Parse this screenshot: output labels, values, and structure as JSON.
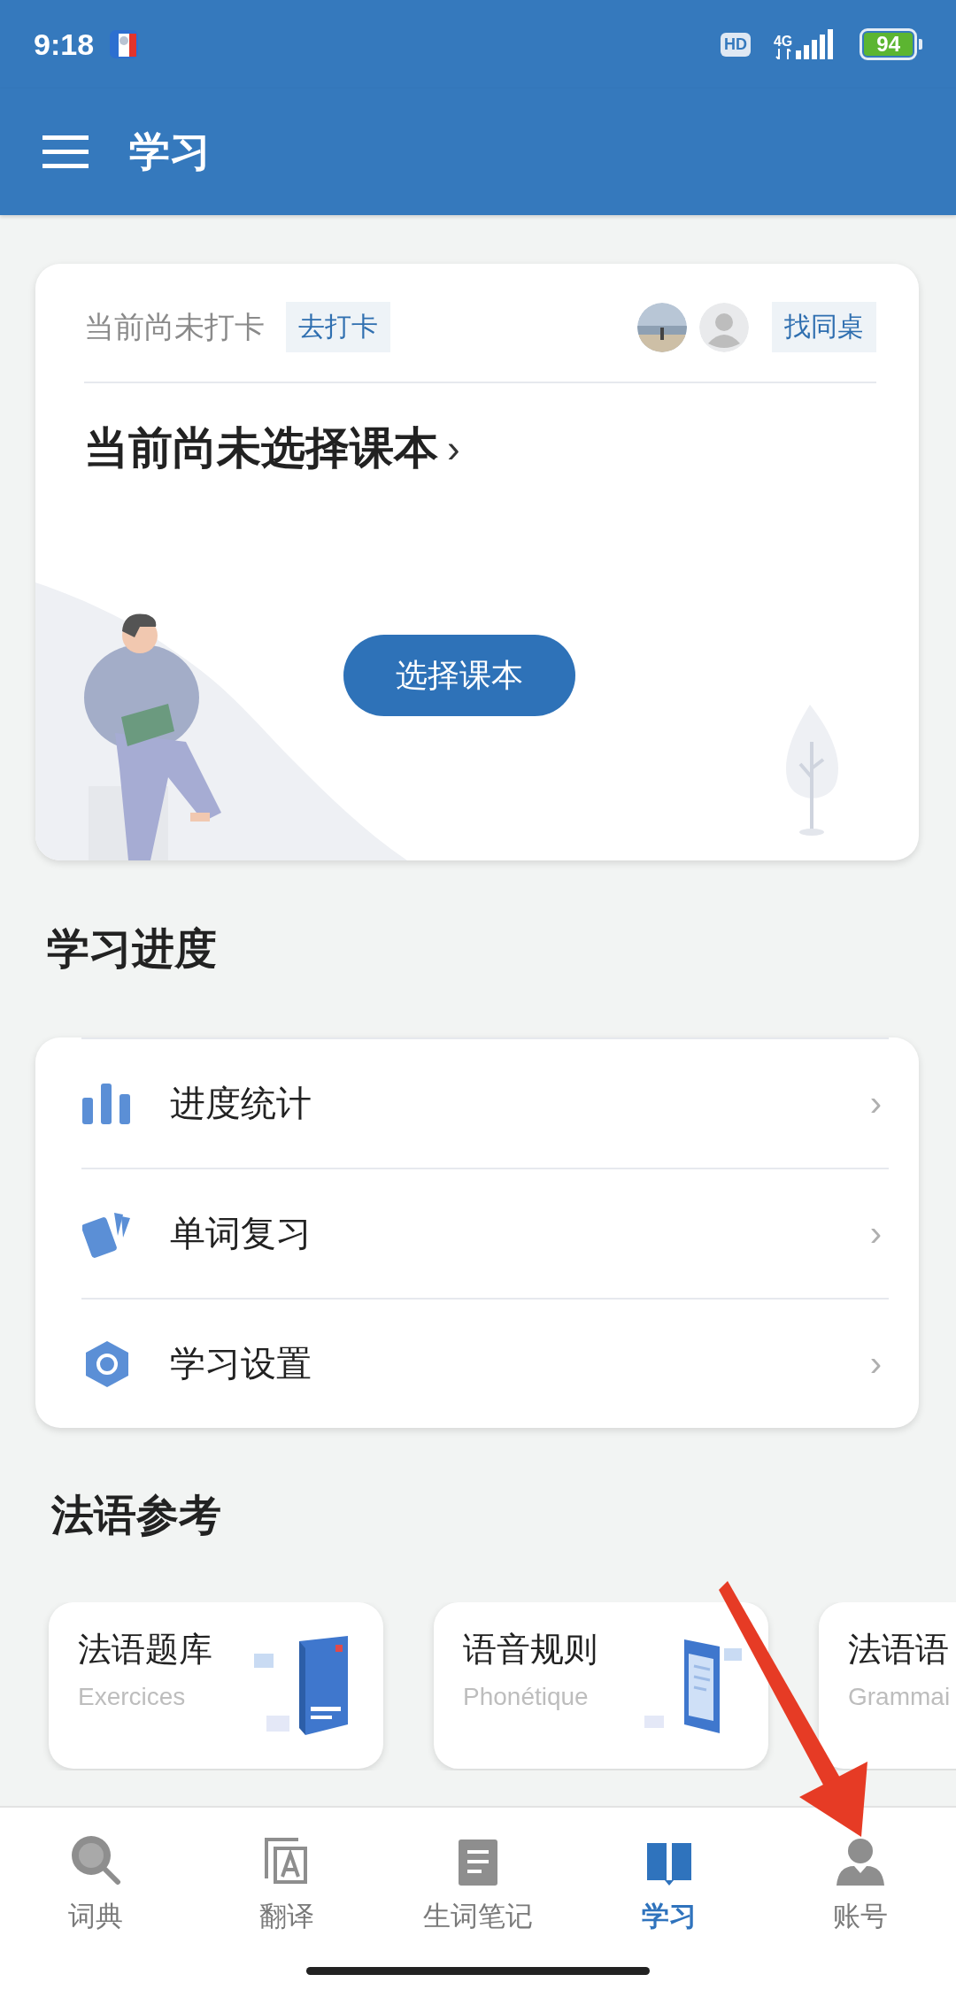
{
  "status_bar": {
    "time": "9:18",
    "hd": "HD",
    "network": "4G",
    "battery": "94"
  },
  "app_bar": {
    "title": "学习"
  },
  "checkin_card": {
    "status": "当前尚未打卡",
    "checkin_button": "去打卡",
    "deskmate_button": "找同桌",
    "textbook_title": "当前尚未选择课本",
    "chevron": "›",
    "choose_button": "选择课本"
  },
  "progress_section": {
    "title": "学习进度",
    "items": [
      {
        "label": "进度统计",
        "chevron": "›"
      },
      {
        "label": "单词复习",
        "chevron": "›"
      },
      {
        "label": "学习设置",
        "chevron": "›"
      }
    ]
  },
  "reference_section": {
    "title": "法语参考",
    "cards": [
      {
        "title": "法语题库",
        "subtitle": "Exercices"
      },
      {
        "title": "语音规则",
        "subtitle": "Phonétique"
      },
      {
        "title": "法语语",
        "subtitle": "Grammai"
      }
    ]
  },
  "bottom_nav": [
    {
      "label": "词典",
      "selected": false
    },
    {
      "label": "翻译",
      "selected": false
    },
    {
      "label": "生词笔记",
      "selected": false
    },
    {
      "label": "学习",
      "selected": true
    },
    {
      "label": "账号",
      "selected": false
    }
  ]
}
